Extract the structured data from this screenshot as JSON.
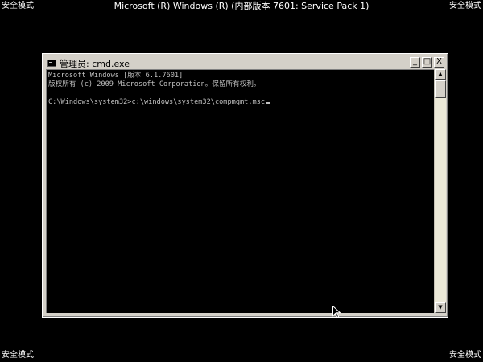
{
  "os": {
    "title": "Microsoft (R) Windows (R) (内部版本 7601: Service Pack 1)",
    "safe_mode_label": "安全模式"
  },
  "window": {
    "title": "管理员: cmd.exe",
    "controls": {
      "minimize": "_",
      "maximize": "□",
      "close": "X"
    },
    "icon": "console-icon"
  },
  "console": {
    "lines": [
      "Microsoft Windows [版本 6.1.7601]",
      "版权所有 (c) 2009 Microsoft Corporation。保留所有权利。",
      "",
      "C:\\Windows\\system32>c:\\windows\\system32\\compmgmt.msc"
    ],
    "text_color": "#c0c0c0",
    "background": "#000000"
  },
  "scrollbar": {
    "up_arrow": "▲",
    "down_arrow": "▼"
  }
}
